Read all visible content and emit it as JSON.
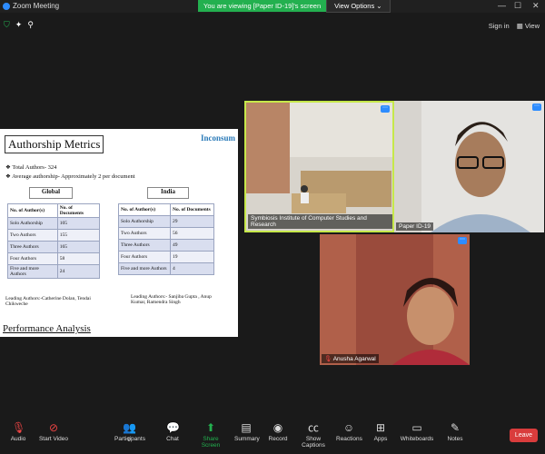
{
  "window": {
    "title": "Zoom Meeting"
  },
  "share_bar": {
    "status": "You are viewing [Paper ID-19]'s screen",
    "view_options": "View Options"
  },
  "top_right": {
    "sign_in": "Sign in",
    "view": "View"
  },
  "slide": {
    "title": "Authorship Metrics",
    "logo": "Inconsum",
    "bullets": [
      "Total Authors- 324",
      "Average authorship- Approximately 2 per document"
    ],
    "global": {
      "heading": "Global",
      "headers": [
        "No. of Author(s)",
        "No. of Documents"
      ],
      "rows": [
        [
          "Solo Authorship",
          "105"
        ],
        [
          "Two Authors",
          "155"
        ],
        [
          "Three Authors",
          "165"
        ],
        [
          "Four Authors",
          "58"
        ],
        [
          "Five and more Authors",
          "24"
        ]
      ],
      "leading": "Leading Authors:-Catherine Dolan, Tendai Chikweche"
    },
    "india": {
      "heading": "India",
      "headers": [
        "No. of Author(s)",
        "No. of Documents"
      ],
      "rows": [
        [
          "Solo Authorship",
          "29"
        ],
        [
          "Two Authors",
          "56"
        ],
        [
          "Three Authors",
          "49"
        ],
        [
          "Four Authors",
          "19"
        ],
        [
          "Five and more Authors",
          "4"
        ]
      ],
      "leading": "Leading Authors:- Sanjiba Gupta , Anup Kumar, Ramendra Singh"
    },
    "footer": "Performance Analysis"
  },
  "participants": [
    {
      "name": "Symbiosis Institute of Computer Studies and Research"
    },
    {
      "name": "Paper ID-19"
    },
    {
      "name": "Anusha Agarwal"
    }
  ],
  "toolbar": {
    "items": [
      "Audio",
      "Start Video",
      "Participants",
      "Chat",
      "Share Screen",
      "Summary",
      "Record",
      "Show Captions",
      "Reactions",
      "Apps",
      "Whiteboards",
      "Notes"
    ],
    "participants_count": "9",
    "leave": "Leave"
  }
}
